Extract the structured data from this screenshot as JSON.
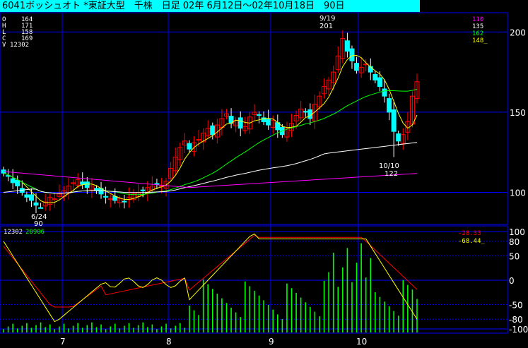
{
  "title": "6041ボッシュオト *東証大型　千株　日足 02年 6月12日～02年10月18日　90日",
  "colors": {
    "up": "#ff0000",
    "down": "#00ffff",
    "grid": "#0000ff",
    "bg": "#000000",
    "ma_short": "#ffff00",
    "ma_mid": "#00ff00",
    "ma_long": "#ffffff",
    "ma_xlong": "#ff00ff",
    "vol": "#00ff00",
    "osc_fast": "#ffff00",
    "osc_slow": "#ff0000"
  },
  "ohlc": {
    "o_label": "O",
    "o": "164",
    "h_label": "H",
    "h": "171",
    "l_label": "L",
    "l": "158",
    "c_label": "C",
    "c": "169",
    "v_label": "V",
    "v": "12302"
  },
  "ma_values": {
    "a": "110",
    "b": "135",
    "c": "162",
    "d": "148_"
  },
  "volume_info": {
    "left": "12302",
    "right": "20906"
  },
  "osc_values": {
    "a": "-28.33",
    "b": "-68.44_"
  },
  "annotations": {
    "high_date": "9/19",
    "high_value": "201",
    "low1_date": "6/24",
    "low1_value": "90",
    "low2_date": "10/10",
    "low2_value": "122"
  },
  "chart_data": [
    {
      "type": "candlestick",
      "title": "",
      "y_ticks": [
        100,
        150,
        200
      ],
      "x_ticks": [
        "7",
        "8",
        "9",
        "10"
      ],
      "ylim": [
        80,
        210
      ],
      "grid": true
    },
    {
      "type": "line",
      "title": "",
      "y_ticks": [
        100,
        80,
        50,
        0,
        -50,
        -80,
        -100
      ],
      "ylim": [
        -100,
        100
      ]
    }
  ]
}
